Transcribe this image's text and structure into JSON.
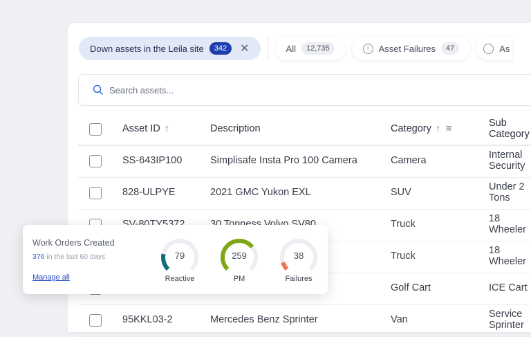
{
  "filters": {
    "active": {
      "label": "Down assets in the Leila site",
      "count": "342"
    },
    "chips": [
      {
        "label": "All",
        "count": "12,735",
        "icon": ""
      },
      {
        "label": "Asset Failures",
        "count": "47",
        "icon": "alert-circle-icon"
      },
      {
        "label": "As",
        "count": "",
        "icon": "timer-icon"
      }
    ]
  },
  "search": {
    "placeholder": "Search assets..."
  },
  "table": {
    "headers": {
      "asset_id": "Asset ID",
      "description": "Description",
      "category": "Category",
      "sub_category": "Sub Category"
    },
    "rows": [
      {
        "id": "SS-643IP100",
        "desc": "Simplisafe Insta Pro 100 Camera",
        "cat": "Camera",
        "sub": "Internal Security"
      },
      {
        "id": "828-ULPYE",
        "desc": "2021 GMC Yukon EXL",
        "cat": "SUV",
        "sub": "Under 2 Tons"
      },
      {
        "id": "SV-80TY5372",
        "desc": "30 Tonness Volvo SV80",
        "cat": "Truck",
        "sub": "18 Wheeler"
      },
      {
        "id": "",
        "desc": "",
        "cat": "Truck",
        "sub": "18 Wheeler"
      },
      {
        "id": "",
        "desc": "",
        "cat": "Golf Cart",
        "sub": "ICE Cart"
      },
      {
        "id": "95KKL03-2",
        "desc": "Mercedes Benz Sprinter",
        "cat": "Van",
        "sub": "Service Sprinter"
      }
    ]
  },
  "work_orders": {
    "title": "Work Orders Created",
    "total": "376",
    "period": "in the last 60 days",
    "link": "Manage all",
    "total_value": 376,
    "gauges": [
      {
        "label": "Reactive",
        "value": "79",
        "n": 79,
        "color": "#0f6e78"
      },
      {
        "label": "PM",
        "value": "259",
        "n": 259,
        "color": "#7fa614"
      },
      {
        "label": "Failures",
        "value": "38",
        "n": 38,
        "color": "#ef7357"
      }
    ]
  }
}
